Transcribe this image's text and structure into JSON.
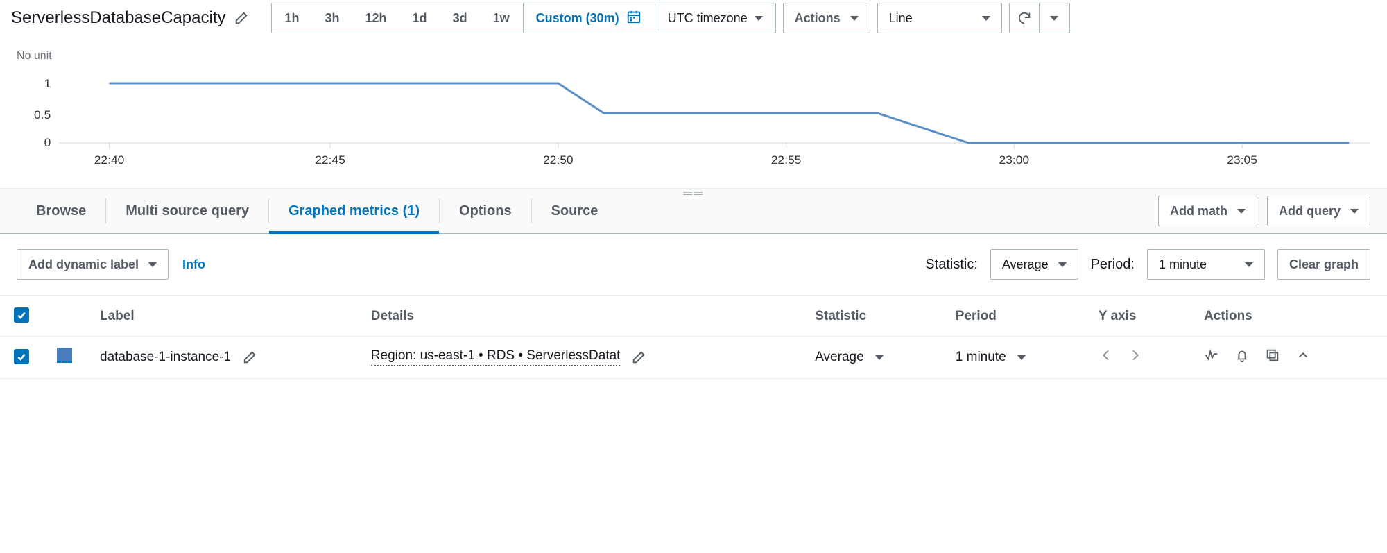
{
  "header": {
    "title": "ServerlessDatabaseCapacity",
    "time_ranges": [
      "1h",
      "3h",
      "12h",
      "1d",
      "3d",
      "1w"
    ],
    "custom_label": "Custom (30m)",
    "timezone": "UTC timezone",
    "actions_label": "Actions",
    "chart_type": "Line"
  },
  "chart_unit": "No unit",
  "chart_data": {
    "type": "line",
    "title": "",
    "xlabel": "",
    "ylabel": "",
    "ylim": [
      0,
      1
    ],
    "yticks": [
      0,
      0.5,
      1
    ],
    "x_categories": [
      "22:40",
      "22:45",
      "22:50",
      "22:55",
      "23:00",
      "23:05"
    ],
    "series": [
      {
        "name": "database-1-instance-1",
        "color": "#5b8fc7",
        "points": [
          {
            "x": "22:40",
            "y": 1
          },
          {
            "x": "22:50",
            "y": 1
          },
          {
            "x": "22:51",
            "y": 0.5
          },
          {
            "x": "22:57",
            "y": 0.5
          },
          {
            "x": "22:59",
            "y": 0
          },
          {
            "x": "23:07",
            "y": 0
          }
        ]
      }
    ]
  },
  "tabs": {
    "items": [
      "Browse",
      "Multi source query",
      "Graphed metrics (1)",
      "Options",
      "Source"
    ],
    "active_index": 2,
    "add_math": "Add math",
    "add_query": "Add query"
  },
  "controls": {
    "add_dynamic_label": "Add dynamic label",
    "info": "Info",
    "statistic_label": "Statistic:",
    "statistic_value": "Average",
    "period_label": "Period:",
    "period_value": "1 minute",
    "clear_graph": "Clear graph"
  },
  "table": {
    "columns": [
      "",
      "",
      "Label",
      "Details",
      "Statistic",
      "Period",
      "Y axis",
      "Actions"
    ],
    "rows": [
      {
        "checked": true,
        "label": "database-1-instance-1",
        "details": "Region: us-east-1 • RDS • ServerlessDatat",
        "statistic": "Average",
        "period": "1 minute"
      }
    ]
  }
}
